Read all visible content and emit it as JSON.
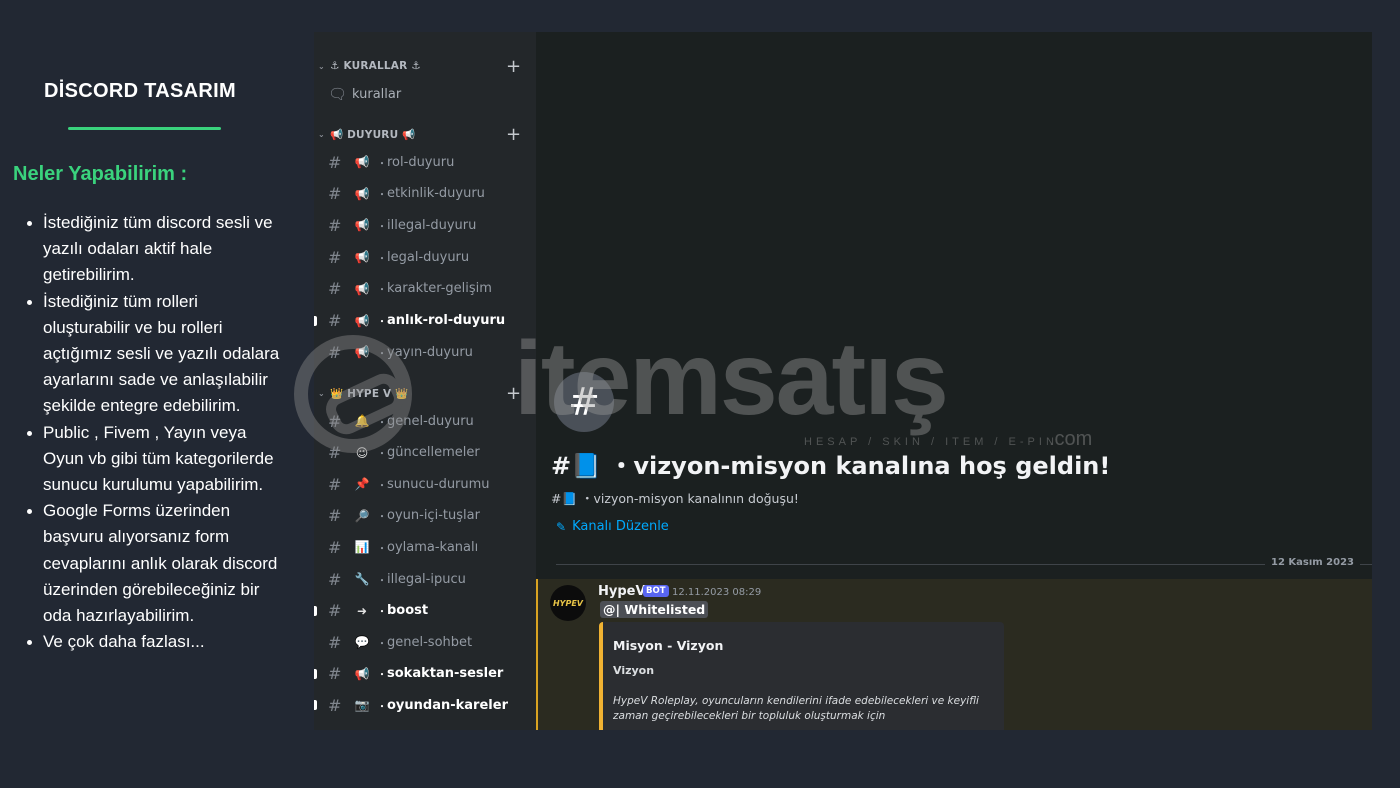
{
  "promo": {
    "title": "DİSCORD TASARIM",
    "subtitle": "Neler Yapabilirim :",
    "items": [
      "İstediğiniz tüm discord sesli ve yazılı odaları aktif hale getirebilirim.",
      "İstediğiniz tüm rolleri oluşturabilir ve bu rolleri açtığımız sesli ve yazılı odalara ayarlarını sade ve anlaşılabilir şekilde entegre edebilirim.",
      "Public , Fivem , Yayın veya Oyun vb gibi tüm kategorilerde sunucu kurulumu yapabilirim.",
      "Google Forms üzerinden başvuru alıyorsanız form cevaplarını anlık olarak discord üzerinden görebileceğiniz bir oda hazırlayabilirim.",
      "Ve çok daha fazlası..."
    ],
    "accent_color": "#3ad37d"
  },
  "discord": {
    "categories": [
      {
        "name": "⚓ KURALLAR ⚓"
      },
      {
        "name": "📢 DUYURU 📢"
      },
      {
        "name": "👑 HYPE V 👑"
      }
    ],
    "rules_channel": {
      "icon": "🗨",
      "name": "kurallar"
    },
    "duyuru_channels": [
      {
        "emoji": "📢",
        "name": "rol-duyuru",
        "unread": false
      },
      {
        "emoji": "📢",
        "name": "etkinlik-duyuru",
        "unread": false
      },
      {
        "emoji": "📢",
        "name": "illegal-duyuru",
        "unread": false
      },
      {
        "emoji": "📢",
        "name": "legal-duyuru",
        "unread": false
      },
      {
        "emoji": "📢",
        "name": "karakter-gelişim",
        "unread": false
      },
      {
        "emoji": "📢",
        "name": "anlık-rol-duyuru",
        "unread": true
      },
      {
        "emoji": "📢",
        "name": "yayın-duyuru",
        "unread": false
      }
    ],
    "hype_channels": [
      {
        "emoji": "🔔",
        "name": "genel-duyuru",
        "unread": false
      },
      {
        "emoji": "😉",
        "name": "güncellemeler",
        "unread": false
      },
      {
        "emoji": "📌",
        "name": "sunucu-durumu",
        "unread": false
      },
      {
        "emoji": "🔎",
        "name": "oyun-içi-tuşlar",
        "unread": false
      },
      {
        "emoji": "📊",
        "name": "oylama-kanalı",
        "unread": false
      },
      {
        "emoji": "🔧",
        "name": "illegal-ipucu",
        "unread": false
      },
      {
        "emoji": "➜",
        "name": "boost",
        "unread": true
      },
      {
        "emoji": "💬",
        "name": "genel-sohbet",
        "unread": false
      },
      {
        "emoji": "📢",
        "name": "sokaktan-sesler",
        "unread": true
      },
      {
        "emoji": "📷",
        "name": "oyundan-kareler",
        "unread": true
      }
    ],
    "welcome": {
      "icon": "#",
      "title": "#📘 ・vizyon-misyon kanalına hoş geldin!",
      "subtitle": "#📘 ・vizyon-misyon kanalının doğuşu!",
      "edit_label": "Kanalı Düzenle"
    },
    "date_divider": "12 Kasım 2023",
    "message": {
      "avatar_text": "HYPEV",
      "author": "HypeV",
      "bot_badge": "BOT",
      "timestamp": "12.11.2023 08:29",
      "mention": "@| Whitelisted",
      "embed_title": "Misyon - Vizyon",
      "embed_field": "Vizyon",
      "embed_desc": "HypeV Roleplay, oyuncuların kendilerini ifade edebilecekleri ve keyifli zaman geçirebilecekleri bir topluluk oluşturmak için"
    }
  },
  "watermark": {
    "text": "itemsatış",
    "tagline": "HESAP / SKIN / ITEM / E-PIN",
    "suffix": ".com"
  }
}
